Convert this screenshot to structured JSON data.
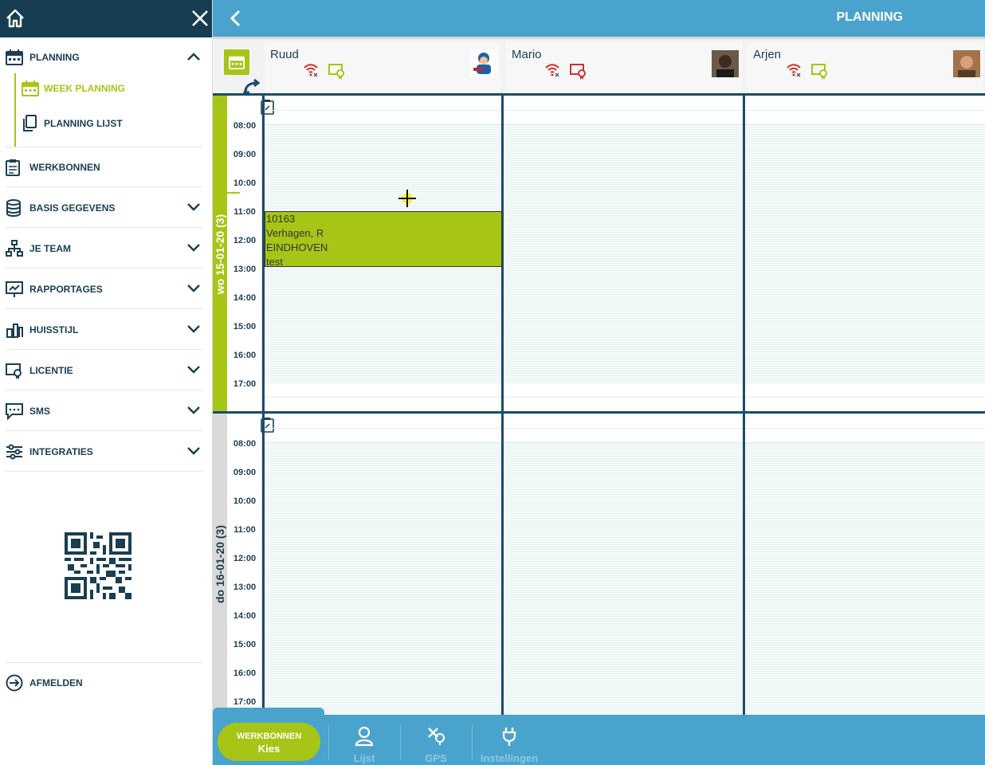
{
  "sidebar": {
    "menu": [
      {
        "label": "PLANNING",
        "icon": "calendar-icon"
      },
      {
        "label": "WEEK PLANNING",
        "icon": "calendar-week-icon"
      },
      {
        "label": "PLANNING LIJST",
        "icon": "copy-list-icon"
      },
      {
        "label": "WERKBONNEN",
        "icon": "clipboard-icon"
      },
      {
        "label": "BASIS GEGEVENS",
        "icon": "database-icon"
      },
      {
        "label": "JE TEAM",
        "icon": "team-hierarchy-icon"
      },
      {
        "label": "RAPPORTAGES",
        "icon": "presentation-icon"
      },
      {
        "label": "HUISSTIJL",
        "icon": "brush-icon"
      },
      {
        "label": "LICENTIE",
        "icon": "license-icon"
      },
      {
        "label": "SMS",
        "icon": "chat-icon"
      },
      {
        "label": "INTEGRATIES",
        "icon": "sliders-icon"
      }
    ],
    "logout_label": "AFMELDEN"
  },
  "header": {
    "title": "PLANNING"
  },
  "resources": [
    {
      "name": "Ruud",
      "avatar": "plumber-mascot",
      "license_color": "#a7c517"
    },
    {
      "name": "Mario",
      "avatar": "photo-man",
      "license_color": "#d32f2f"
    },
    {
      "name": "Arjen",
      "avatar": "photo-man-2",
      "license_color": "#a7c517"
    }
  ],
  "days": [
    {
      "label": "wo 15-01-20 (3)",
      "color": "#a7c517",
      "times": [
        "08:00",
        "09:00",
        "10:00",
        "11:00",
        "12:00",
        "13:00",
        "14:00",
        "15:00",
        "16:00",
        "17:00"
      ]
    },
    {
      "label": "do 16-01-20 (3)",
      "color": "#d9d9d9",
      "times": [
        "08:00",
        "09:00",
        "10:00",
        "11:00",
        "12:00",
        "13:00",
        "14:00",
        "15:00",
        "16:00",
        "17:00"
      ]
    }
  ],
  "appointment": {
    "number": "10163",
    "customer": "Verhagen, R",
    "city": "EINDHOVEN",
    "note": "test"
  },
  "bottom": {
    "werkbonnen_line1": "WERKBONNEN",
    "werkbonnen_line2": "Kies",
    "nav": [
      {
        "label": "Lijst",
        "icon": "person-icon"
      },
      {
        "label": "GPS",
        "icon": "gps-tools-icon"
      },
      {
        "label": "Instellingen",
        "icon": "plug-icon"
      }
    ]
  },
  "colors": {
    "navy": "#173d52",
    "accent": "#a7c517",
    "blue": "#4aa3cc"
  }
}
